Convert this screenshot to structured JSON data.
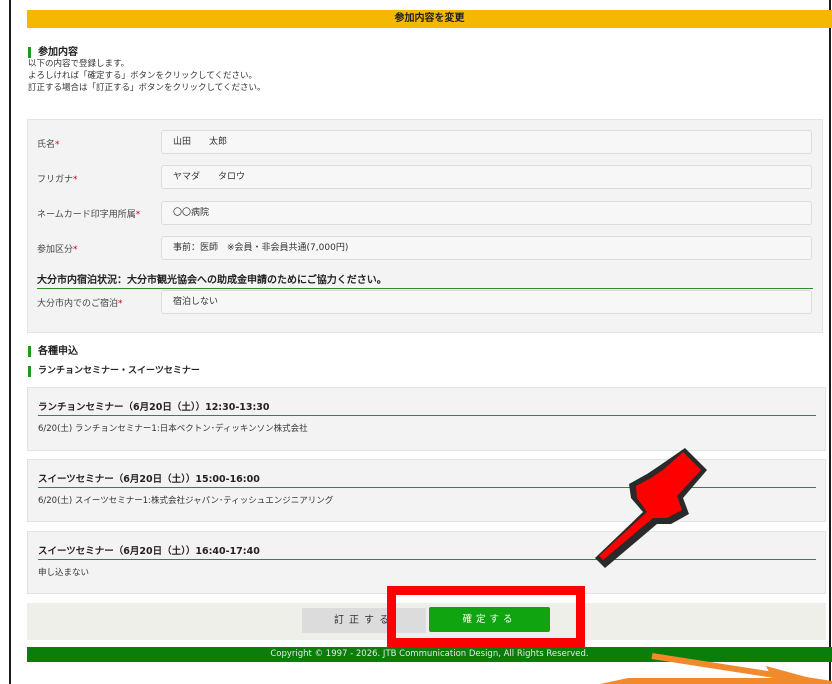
{
  "header": {
    "title": "参加内容を変更"
  },
  "participation": {
    "heading": "参加内容",
    "intro": [
      "以下の内容で登録します。",
      "よろしければ「確定する」ボタンをクリックしてください。",
      "訂正する場合は「訂正する」ボタンをクリックしてください。"
    ],
    "required_mark": "*",
    "fields": {
      "name": {
        "label": "氏名",
        "value": "山田　　太郎"
      },
      "furigana": {
        "label": "フリガナ",
        "value": "ヤマダ　　タロウ"
      },
      "affiliation": {
        "label": "ネームカード印字用所属",
        "value": "〇〇病院"
      },
      "category": {
        "label": "参加区分",
        "value": "事前：医師　※会員・非会員共通(7,000円)"
      },
      "stay": {
        "label": "大分市内でのご宿泊",
        "value": "宿泊しない"
      }
    },
    "stay_heading": "大分市内宿泊状況：大分市観光協会への助成金申請のためにご協力ください。"
  },
  "applications": {
    "heading": "各種申込",
    "subheading": "ランチョンセミナー・スイーツセミナー",
    "seminars": [
      {
        "title": "ランチョンセミナー（6月20日（土））12:30-13:30",
        "detail": "6/20(土) ランチョンセミナー1:日本ベクトン･ディッキンソン株式会社"
      },
      {
        "title": "スイーツセミナー（6月20日（土））15:00-16:00",
        "detail": "6/20(土) スイーツセミナー1:株式会社ジャパン･ティッシュエンジニアリング"
      },
      {
        "title": "スイーツセミナー（6月20日（土））16:40-17:40",
        "detail": "申し込まない"
      }
    ]
  },
  "buttons": {
    "correct": "訂正する",
    "confirm": "確定する"
  },
  "footer": {
    "copyright": "Copyright © 1997 - 2026. JTB Communication Design, All Rights Reserved."
  },
  "colors": {
    "header_bg": "#f5b800",
    "accent_green": "#1e9a1e",
    "confirm_green": "#11a411",
    "footer_green": "#0a7d0a",
    "required": "#d0021b",
    "annotation_red": "#ff0000",
    "annotation_orange": "#f08a2c"
  },
  "annotations": {
    "pointer_icon": "hand-pointer-icon",
    "arrow_icon": "arrow-icon"
  }
}
